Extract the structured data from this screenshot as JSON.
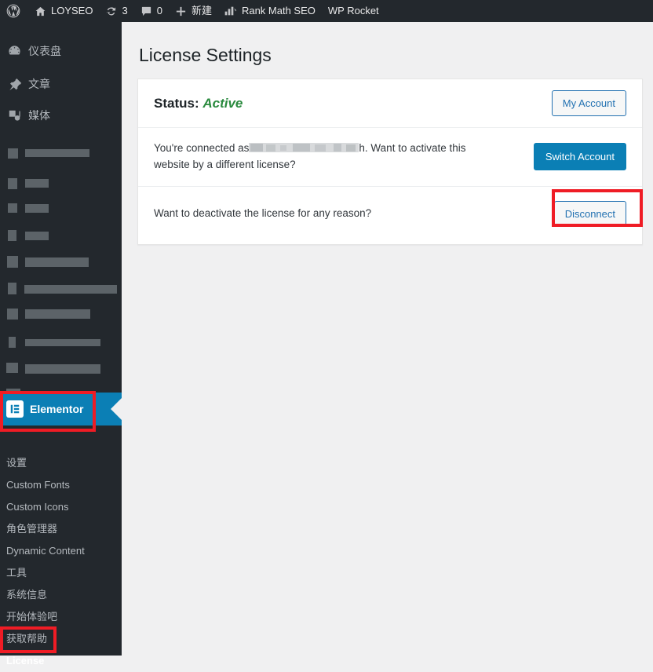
{
  "adminbar": {
    "items": [
      {
        "icon": "wordpress-logo-icon",
        "label": ""
      },
      {
        "icon": "home-icon",
        "label": "LOYSEO"
      },
      {
        "icon": "updates-icon",
        "label": "3"
      },
      {
        "icon": "comments-icon",
        "label": "0"
      },
      {
        "icon": "plus-icon",
        "label": "新建"
      },
      {
        "icon": "rank-math-icon",
        "label": "Rank Math SEO"
      },
      {
        "icon": "",
        "label": "WP Rocket"
      }
    ]
  },
  "sidebar": {
    "items": [
      {
        "label": "仪表盘",
        "icon": "dashboard-icon",
        "blurred": false
      },
      {
        "label": "文章",
        "icon": "post-pin-icon",
        "blurred": false
      },
      {
        "label": "媒体",
        "icon": "media-icon",
        "blurred": false
      },
      {
        "label": "",
        "icon": "",
        "blurred": true
      },
      {
        "label": "",
        "icon": "",
        "blurred": true
      },
      {
        "label": "",
        "icon": "",
        "blurred": true
      },
      {
        "label": "",
        "icon": "",
        "blurred": true
      },
      {
        "label": "",
        "icon": "",
        "blurred": true
      },
      {
        "label": "",
        "icon": "",
        "blurred": true
      },
      {
        "label": "",
        "icon": "",
        "blurred": true
      },
      {
        "label": "",
        "icon": "",
        "blurred": true
      },
      {
        "label": "",
        "icon": "",
        "blurred": true
      },
      {
        "label": "",
        "icon": "",
        "blurred": true
      }
    ],
    "elementor": {
      "label": "Elementor",
      "icon": "elementor-icon",
      "active": true,
      "highlight_color": "#0b7fb5"
    },
    "submenu": [
      {
        "label": "设置",
        "current": false
      },
      {
        "label": "Custom Fonts",
        "current": false
      },
      {
        "label": "Custom Icons",
        "current": false
      },
      {
        "label": "角色管理器",
        "current": false
      },
      {
        "label": "Dynamic Content",
        "current": false
      },
      {
        "label": "工具",
        "current": false
      },
      {
        "label": "系统信息",
        "current": false
      },
      {
        "label": "开始体验吧",
        "current": false
      },
      {
        "label": "获取帮助",
        "current": false
      },
      {
        "label": "License",
        "current": true
      }
    ]
  },
  "main": {
    "page_title": "License Settings",
    "card": {
      "status_label": "Status:",
      "status_value": "Active",
      "status_color": "#2a8a3e",
      "my_account_button": "My Account",
      "connected_text_before": "You're connected as",
      "connected_text_after": "h. Want to activate this website by a different license?",
      "switch_account_button": "Switch Account",
      "deactivate_text": "Want to deactivate the license for any reason?",
      "disconnect_button": "Disconnect"
    }
  },
  "annotations": {
    "color": "#ef1c25",
    "boxes": [
      "elementor-menu-item",
      "license-submenu-item",
      "disconnect-button"
    ]
  }
}
